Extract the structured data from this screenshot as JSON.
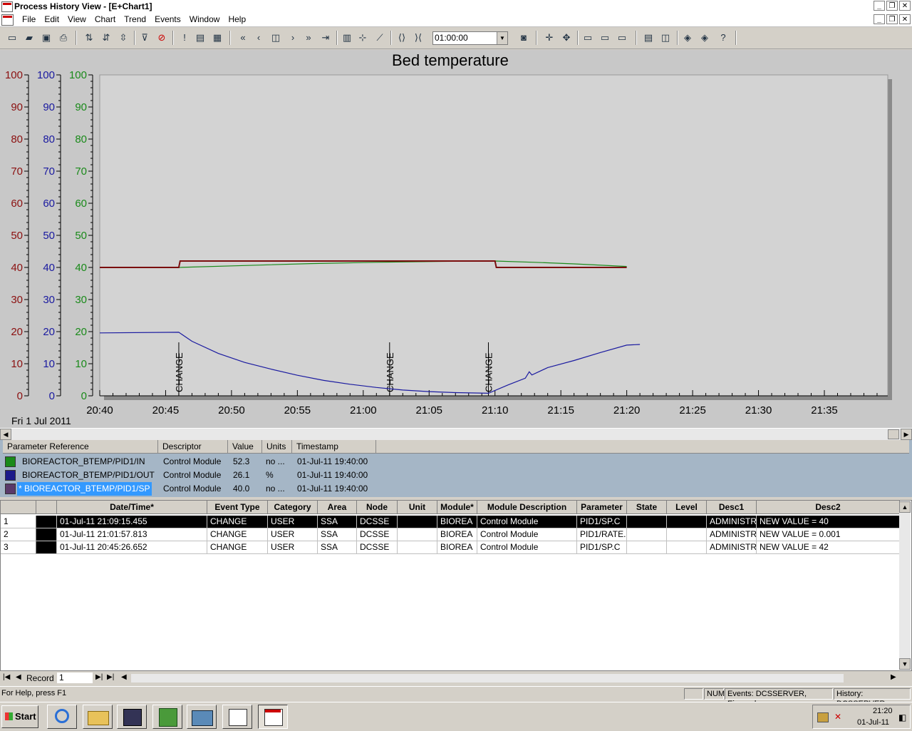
{
  "window": {
    "title": "Process History View - [E+Chart1]",
    "minimize": "_",
    "restore": "❐",
    "close": "✕"
  },
  "menu": [
    "File",
    "Edit",
    "View",
    "Chart",
    "Trend",
    "Events",
    "Window",
    "Help"
  ],
  "toolbar": {
    "time_span": "01:00:00"
  },
  "chart_data": {
    "type": "line",
    "title": "Bed temperature",
    "date_label": "Fri 1 Jul 2011",
    "y_axes": [
      {
        "color": "#8b1010",
        "range": [
          0,
          100
        ],
        "ticks": [
          "0",
          "10",
          "20",
          "30",
          "40",
          "50",
          "60",
          "70",
          "80",
          "90",
          "100"
        ]
      },
      {
        "color": "#1a1aa0",
        "range": [
          0,
          100
        ],
        "ticks": [
          "0",
          "10",
          "20",
          "30",
          "40",
          "50",
          "60",
          "70",
          "80",
          "90",
          "100"
        ]
      },
      {
        "color": "#1a8a1a",
        "range": [
          0,
          100
        ],
        "ticks": [
          "0",
          "10",
          "20",
          "30",
          "40",
          "50",
          "60",
          "70",
          "80",
          "90",
          "100"
        ]
      }
    ],
    "x_range_minutes": [
      0,
      60
    ],
    "x_ticks": [
      {
        "label": "20:40",
        "m": 0
      },
      {
        "label": "20:45",
        "m": 5
      },
      {
        "label": "20:50",
        "m": 10
      },
      {
        "label": "20:55",
        "m": 15
      },
      {
        "label": "21:00",
        "m": 20
      },
      {
        "label": "21:05",
        "m": 25
      },
      {
        "label": "21:10",
        "m": 30
      },
      {
        "label": "21:15",
        "m": 35
      },
      {
        "label": "21:20",
        "m": 40
      },
      {
        "label": "21:25",
        "m": 45
      },
      {
        "label": "21:30",
        "m": 50
      },
      {
        "label": "21:35",
        "m": 55
      }
    ],
    "series": [
      {
        "name": "BIOREACTOR_BTEMP/PID1/IN",
        "color": "#1a8a1a",
        "points": [
          [
            0,
            40
          ],
          [
            6,
            40
          ],
          [
            11,
            40.6
          ],
          [
            16,
            41.2
          ],
          [
            21,
            41.6
          ],
          [
            26,
            41.9
          ],
          [
            30,
            42
          ],
          [
            33,
            41.6
          ],
          [
            36,
            41.1
          ],
          [
            40,
            40.3
          ]
        ]
      },
      {
        "name": "BIOREACTOR_BTEMP/PID1/OUT",
        "color": "#1a1aa0",
        "points": [
          [
            0,
            19.6
          ],
          [
            6,
            19.8
          ],
          [
            7,
            17
          ],
          [
            9,
            13.2
          ],
          [
            11,
            10.4
          ],
          [
            13,
            8.3
          ],
          [
            15,
            6.4
          ],
          [
            17,
            4.8
          ],
          [
            19,
            3.6
          ],
          [
            21,
            2.6
          ],
          [
            23,
            1.8
          ],
          [
            25,
            1.3
          ],
          [
            27,
            1
          ],
          [
            29.5,
            0.8
          ],
          [
            31,
            3.4
          ],
          [
            32.3,
            5.5
          ],
          [
            32.6,
            7.5
          ],
          [
            32.8,
            6.5
          ],
          [
            34,
            8.8
          ],
          [
            36,
            11
          ],
          [
            38,
            13.5
          ],
          [
            40,
            15.8
          ],
          [
            41,
            16
          ]
        ]
      },
      {
        "name": "BIOREACTOR_BTEMP/PID1/SP",
        "color": "#7a0e0e",
        "points": [
          [
            0,
            40
          ],
          [
            6,
            40
          ],
          [
            6.1,
            42
          ],
          [
            30,
            42
          ],
          [
            30.1,
            40
          ],
          [
            40,
            40
          ]
        ]
      }
    ],
    "events": [
      {
        "label": "CHANGE",
        "m": 6
      },
      {
        "label": "CHANGE",
        "m": 22
      },
      {
        "label": "CHANGE",
        "m": 29.5
      }
    ]
  },
  "legend": {
    "headers": [
      "Parameter Reference",
      "Descriptor",
      "Value",
      "Units",
      "Timestamp"
    ],
    "rows": [
      {
        "color": "#1a8a1a",
        "ref": "BIOREACTOR_BTEMP/PID1/IN",
        "desc": "Control Module",
        "value": "52.3",
        "units": "no ...",
        "ts": "01-Jul-11 19:40:00"
      },
      {
        "color": "#1a1a8a",
        "ref": "BIOREACTOR_BTEMP/PID1/OUT",
        "desc": "Control Module",
        "value": "26.1",
        "units": "%",
        "ts": "01-Jul-11 19:40:00"
      },
      {
        "color": "#5a3a6a",
        "ref": "* BIOREACTOR_BTEMP/PID1/SP",
        "desc": "Control Module",
        "value": "40.0",
        "units": "no ...",
        "ts": "01-Jul-11 19:40:00"
      }
    ]
  },
  "events_table": {
    "headers": [
      "Date/Time*",
      "Event Type",
      "Category",
      "Area",
      "Node",
      "Unit",
      "Module*",
      "Module Description",
      "Parameter",
      "State",
      "Level",
      "Desc1",
      "Desc2"
    ],
    "rows": [
      {
        "num": "1",
        "dt": "01-Jul-11 21:09:15.455",
        "type": "CHANGE",
        "cat": "USER",
        "area": "SSA",
        "node": "DCSSE",
        "unit": "",
        "module": "BIOREA",
        "mdesc": "Control Module",
        "param": "PID1/SP.C",
        "state": "",
        "level": "",
        "desc1": "ADMINISTR",
        "desc2": "NEW VALUE = 40"
      },
      {
        "num": "2",
        "dt": "01-Jul-11 21:01:57.813",
        "type": "CHANGE",
        "cat": "USER",
        "area": "SSA",
        "node": "DCSSE",
        "unit": "",
        "module": "BIOREA",
        "mdesc": "Control Module",
        "param": "PID1/RATE.",
        "state": "",
        "level": "",
        "desc1": "ADMINISTR",
        "desc2": "NEW VALUE = 0.001"
      },
      {
        "num": "3",
        "dt": "01-Jul-11 20:45:26.652",
        "type": "CHANGE",
        "cat": "USER",
        "area": "SSA",
        "node": "DCSSE",
        "unit": "",
        "module": "BIOREA",
        "mdesc": "Control Module",
        "param": "PID1/SP.C",
        "state": "",
        "level": "",
        "desc1": "ADMINISTR",
        "desc2": "NEW VALUE = 42"
      }
    ],
    "record_label": "Record",
    "record_value": "1"
  },
  "status": {
    "help": "For Help, press F1",
    "num": "NUM",
    "events": "Events: DCSSERVER, Ejournal",
    "history": "History: DCSSERVER"
  },
  "taskbar": {
    "start": "Start",
    "clock_time": "21:20",
    "clock_date": "01-Jul-11"
  }
}
